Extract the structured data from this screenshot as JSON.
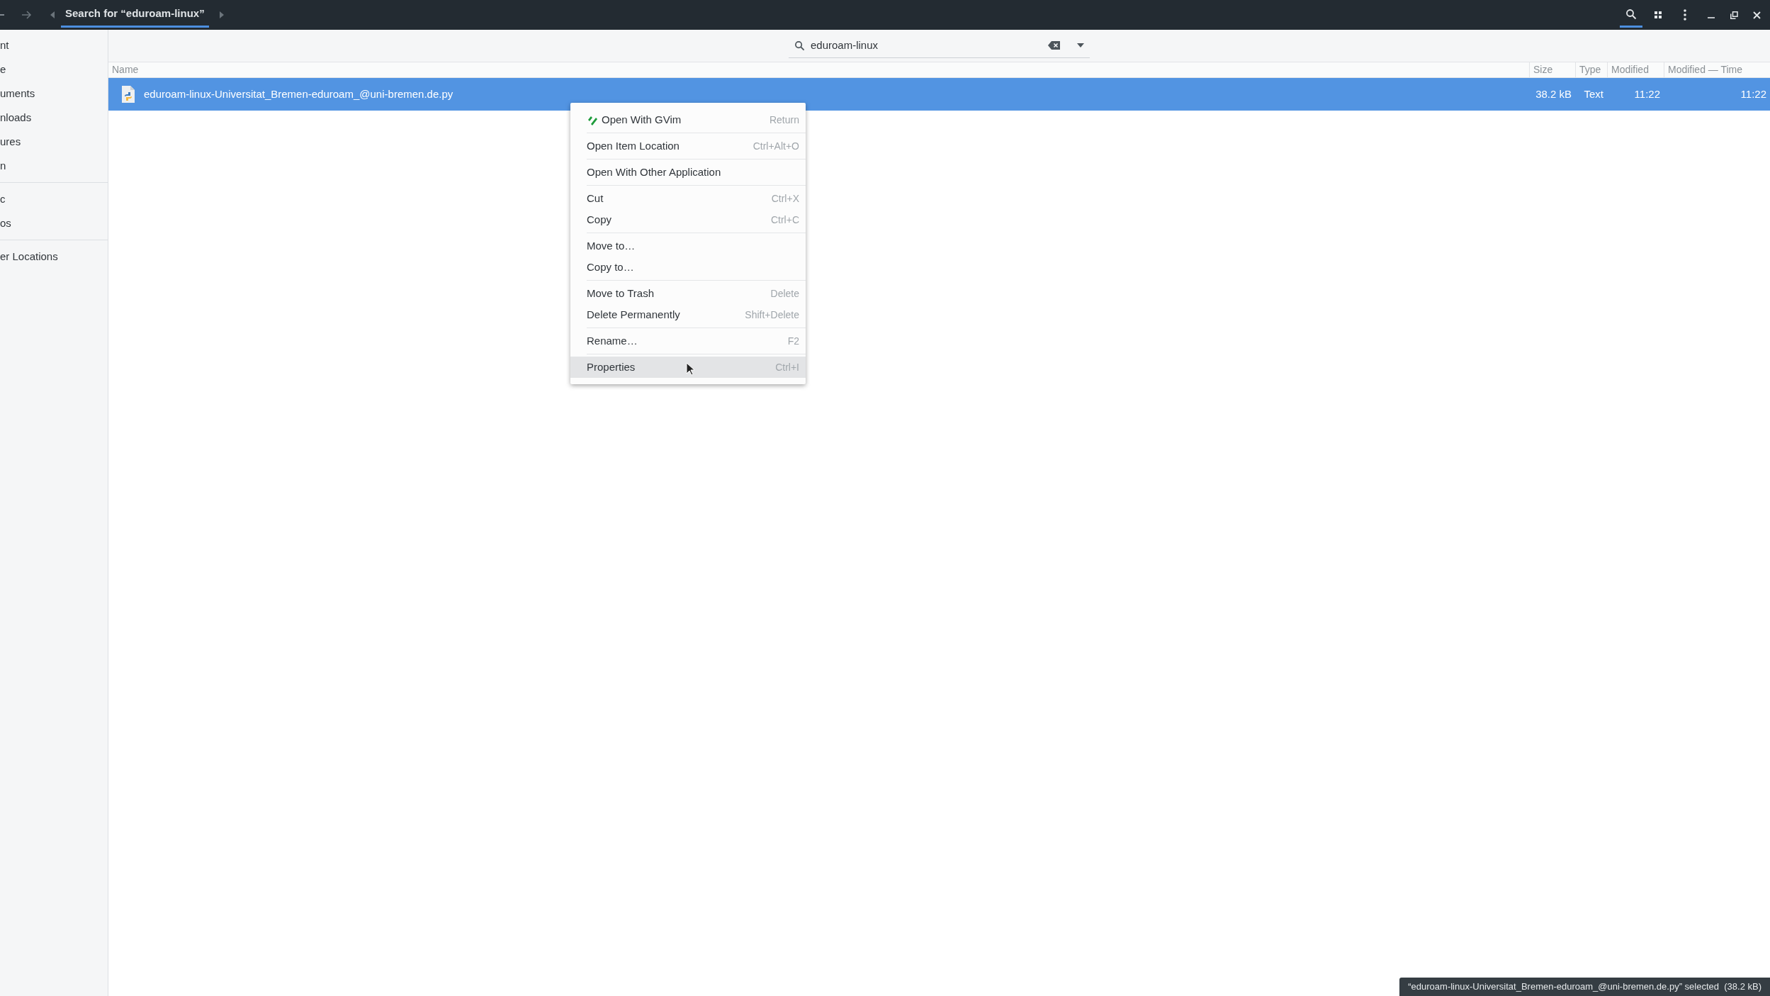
{
  "header": {
    "tab": {
      "label": "Search for “eduroam-linux”",
      "selected": true
    },
    "search_toggle": {
      "selected": true
    }
  },
  "search": {
    "value": "eduroam-linux"
  },
  "sidebar": {
    "groups": [
      [
        "nt",
        "e",
        "uments",
        "nloads",
        "ures",
        "n"
      ],
      [
        "c",
        "os"
      ],
      [
        "er Locations"
      ]
    ]
  },
  "table": {
    "columns": [
      "Name",
      "Size",
      "Type",
      "Modified",
      "Modified — Time"
    ],
    "rows": [
      {
        "cells": [
          "eduroam-linux-Universitat_Bremen-eduroam_@uni-bremen.de.py",
          "38.2 kB",
          "Text",
          "11:22",
          "11:22"
        ],
        "selected": true
      }
    ]
  },
  "context_menu": {
    "groups": [
      [
        {
          "kind": "app",
          "label": "Open With GVim",
          "shortcut": "Return",
          "selected": false
        }
      ],
      [
        {
          "kind": "plain",
          "label": "Open Item Location",
          "shortcut": "Ctrl+Alt+O",
          "selected": false
        }
      ],
      [
        {
          "kind": "plain",
          "label": "Open With Other Application",
          "selected": false
        }
      ],
      [
        {
          "kind": "plain",
          "label": "Cut",
          "shortcut": "Ctrl+X",
          "selected": false
        },
        {
          "kind": "plain",
          "label": "Copy",
          "shortcut": "Ctrl+C",
          "selected": false
        }
      ],
      [
        {
          "kind": "plain",
          "label": "Move to…",
          "selected": false
        },
        {
          "kind": "plain",
          "label": "Copy to…",
          "selected": false
        }
      ],
      [
        {
          "kind": "plain",
          "label": "Move to Trash",
          "shortcut": "Delete",
          "selected": false
        },
        {
          "kind": "plain",
          "label": "Delete Permanently",
          "shortcut": "Shift+Delete",
          "selected": false
        }
      ],
      [
        {
          "kind": "plain",
          "label": "Rename…",
          "shortcut": "F2",
          "selected": false
        }
      ],
      [
        {
          "kind": "plain",
          "label": "Properties",
          "shortcut": "Ctrl+I",
          "selected": true
        }
      ]
    ]
  },
  "status_bar": {
    "text": "“eduroam-linux-Universitat_Bremen-eduroam_@uni-bremen.de.py” selected  (38.2 kB)"
  }
}
